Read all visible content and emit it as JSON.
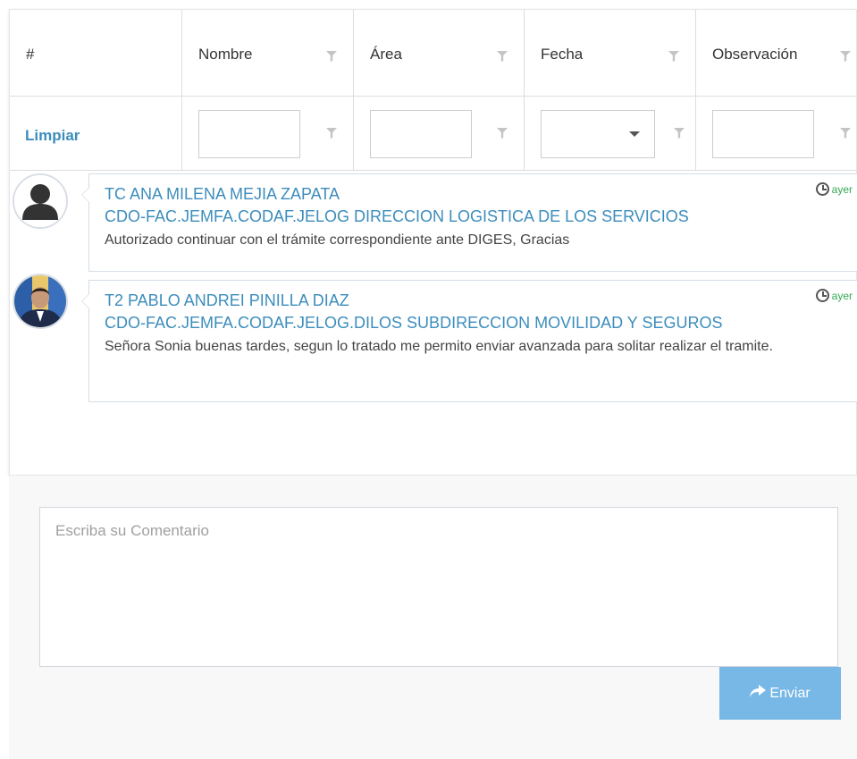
{
  "table": {
    "headers": [
      {
        "label": "#"
      },
      {
        "label": "Nombre"
      },
      {
        "label": "Área"
      },
      {
        "label": "Fecha"
      },
      {
        "label": "Observación"
      }
    ],
    "filter": {
      "clear_label": "Limpiar"
    }
  },
  "comments": [
    {
      "name": "TC ANA MILENA MEJIA ZAPATA",
      "area": "CDO-FAC.JEMFA.CODAF.JELOG DIRECCION LOGISTICA DE LOS SERVICIOS",
      "text": "Autorizado continuar con el trámite correspondiente ante DIGES, Gracias",
      "time": "ayer",
      "avatar": "default-user-icon"
    },
    {
      "name": "T2 PABLO ANDREI PINILLA DIAZ",
      "area": "CDO-FAC.JEMFA.CODAF.JELOG.DILOS SUBDIRECCION MOVILIDAD Y SEGUROS",
      "text": "Señora Sonia buenas tardes, segun lo tratado me permito enviar avanzada para solitar realizar el tramite.",
      "time": "ayer",
      "avatar": "user-photo"
    }
  ],
  "form": {
    "placeholder": "Escriba su Comentario",
    "submit_label": "Enviar",
    "submit_icon": "share-icon"
  },
  "colors": {
    "link": "#3c8dbc",
    "time": "#34a853",
    "button": "#78b8e6"
  }
}
